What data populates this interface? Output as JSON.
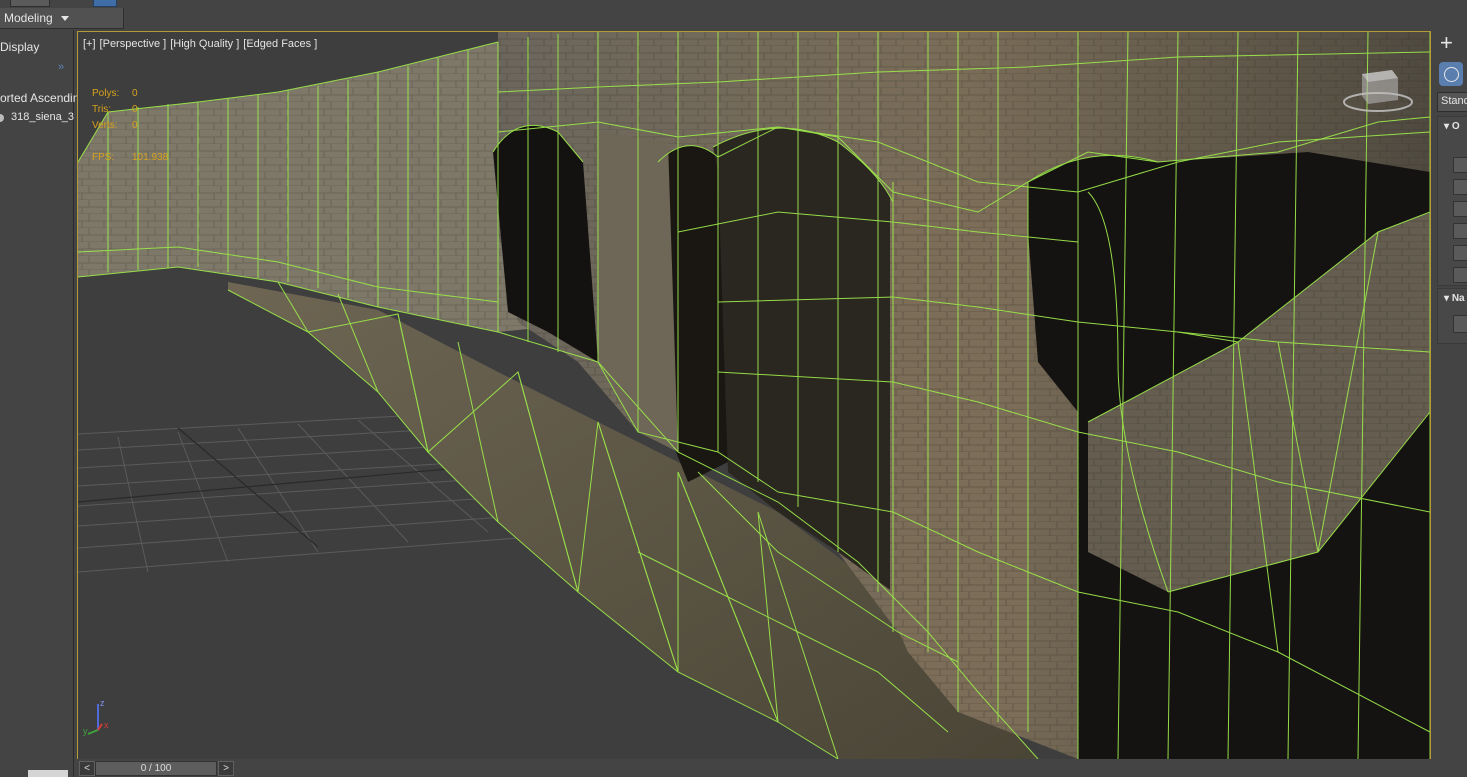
{
  "ribbon": {
    "tab_label": "Modeling"
  },
  "left_panel": {
    "display_label": "Display",
    "expand_glyph": "»",
    "sort_label": "orted Ascendin",
    "scene_item": "318_siena_3"
  },
  "viewport": {
    "label_plus": "[+]",
    "label_view": "[Perspective ]",
    "label_quality": "[High Quality ]",
    "label_faces": "[Edged Faces ]",
    "stats": {
      "polys_label": "Polys:",
      "polys_value": "0",
      "tris_label": "Tris:",
      "tris_value": "0",
      "verts_label": "Verts:",
      "verts_value": "0",
      "fps_label": "FPS:",
      "fps_value": "101.938"
    },
    "axis": {
      "x": "x",
      "y": "y",
      "z": "z"
    }
  },
  "right_panel": {
    "create_icon": "plus-icon",
    "geometry_icon": "sphere-icon",
    "dropdown_label": "Stand",
    "rollout1_label": "O",
    "rollout2_label": "Na"
  },
  "timeline": {
    "prev_label": "<",
    "frame_label": "0 / 100",
    "next_label": ">"
  },
  "colors": {
    "wireframe": "#9be54a",
    "viewport_border": "#b39a35",
    "stats_text": "#d8a21d",
    "ui_background": "#444444"
  }
}
